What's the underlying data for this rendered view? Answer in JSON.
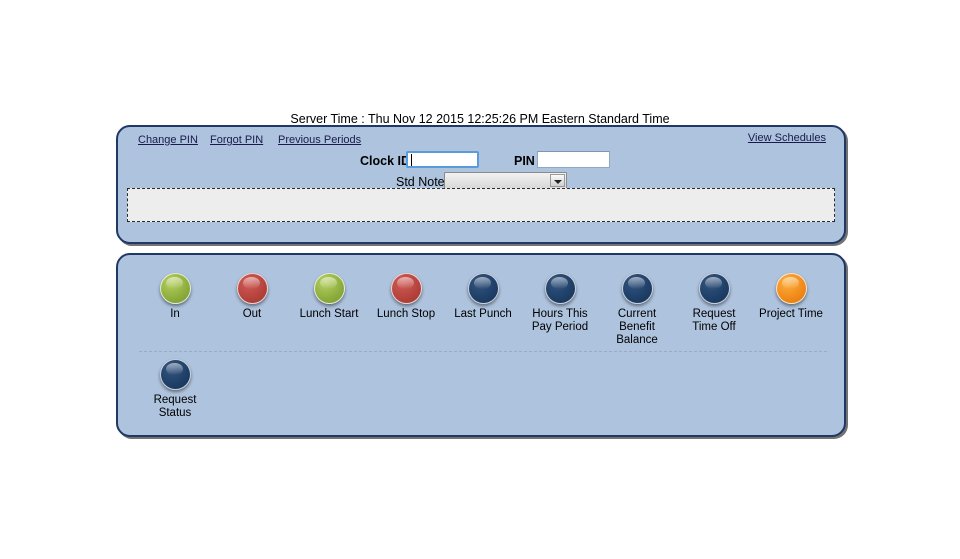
{
  "server_time": {
    "text": "Server Time : Thu Nov 12 2015 12:25:26 PM Eastern Standard Time"
  },
  "top_panel": {
    "links": [
      {
        "label": "Change PIN"
      },
      {
        "label": "Forgot PIN"
      },
      {
        "label": "Previous Periods"
      },
      {
        "label": "View Schedules"
      }
    ],
    "clock_id": {
      "label": "Clock ID",
      "value": "",
      "placeholder": ""
    },
    "pin": {
      "label": "PIN",
      "value": "",
      "placeholder": ""
    },
    "std_note": {
      "label": "Std Note:",
      "selected": "",
      "options": [
        ""
      ]
    },
    "message_area": {
      "text": ""
    }
  },
  "actions": {
    "primary_row": [
      {
        "label": "In",
        "color": "#8fb03f",
        "style": "green"
      },
      {
        "label": "Out",
        "color": "#b7443e",
        "style": "red"
      },
      {
        "label": "Lunch Start",
        "color": "#8fb03f",
        "style": "green"
      },
      {
        "label": "Lunch Stop",
        "color": "#b7443e",
        "style": "red"
      },
      {
        "label": "Last Punch",
        "color": "#1f4069",
        "style": "navy"
      },
      {
        "label": "Hours This Pay Period",
        "color": "#1f4069",
        "style": "navy"
      },
      {
        "label": "Current Benefit Balance",
        "color": "#1f4069",
        "style": "navy"
      },
      {
        "label": "Request Time Off",
        "color": "#1f4069",
        "style": "navy"
      },
      {
        "label": "Project Time",
        "color": "#f28c1c",
        "style": "orange"
      }
    ],
    "secondary_row": [
      {
        "label": "Request Status",
        "color": "#1f4069",
        "style": "navy"
      }
    ]
  },
  "theme": {
    "panel_background": "#aec3de",
    "panel_border": "#1f3864",
    "page_background": "#ffffff",
    "message_background": "#ededed",
    "focus_border": "#5a9bd9"
  }
}
